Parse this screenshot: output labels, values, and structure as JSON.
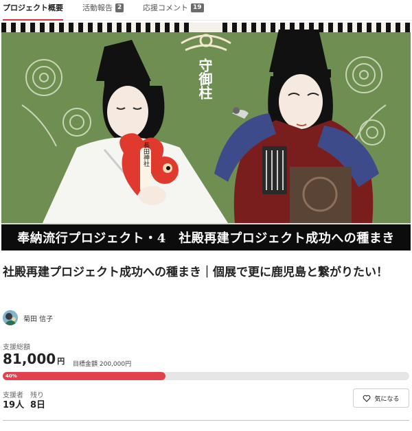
{
  "tabs": [
    {
      "label": "プロジェクト概要",
      "badge": null
    },
    {
      "label": "活動報告",
      "badge": "2"
    },
    {
      "label": "応援コメント",
      "badge": "19"
    }
  ],
  "hero": {
    "vertical_text": "守御柱",
    "charm_text": "長田神社",
    "caption": "奉納流行プロジェクト・4　社殿再建プロジェクト成功への種まき"
  },
  "project": {
    "title": "社殿再建プロジェクト成功への種まき｜個展で更に鹿児島と繋がりたい！",
    "owner_name": "菊田 信子"
  },
  "funding": {
    "total_label": "支援総額",
    "total_amount": "81,000",
    "currency_unit": "円",
    "goal_text": "目標金額 200,000円",
    "progress_percent": 40,
    "progress_label": "40%",
    "supporters_label": "支援者",
    "supporters_value": "19人",
    "remaining_label": "残り",
    "remaining_value": "8日"
  },
  "actions": {
    "favorite_label": "気になる"
  },
  "colors": {
    "accent": "#d9303a",
    "progress_fill": "#e0414a",
    "hero_background": "#6f8e52"
  },
  "icons": {
    "favorite": "heart-outline-icon"
  }
}
